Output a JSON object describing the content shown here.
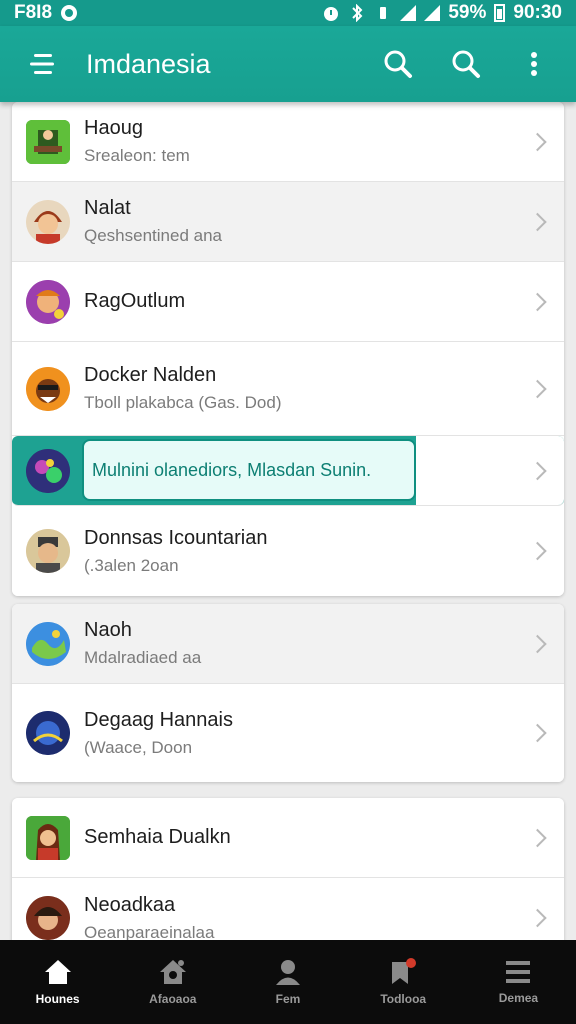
{
  "status_bar": {
    "time_left": "F8I8",
    "battery_pct": "59%",
    "clock": "90:30"
  },
  "app_bar": {
    "title": "Imdanesia",
    "icons": [
      "menu-icon",
      "search-icon",
      "search-icon",
      "more-vert-icon"
    ]
  },
  "colors": {
    "primary": "#17a090",
    "highlight_text": "#0d7f73",
    "nav_bg": "#0c0c0c"
  },
  "list": {
    "items": [
      {
        "name": "Haoug",
        "subtitle": "Srealeon: tem",
        "icon": "game-avatar-icon"
      },
      {
        "name": "Nalat",
        "subtitle": "Qeshsentined ana",
        "icon": "avatar-icon"
      },
      {
        "name": "RagOutlum",
        "subtitle": "",
        "icon": "avatar-icon"
      },
      {
        "name": "Docker Nalden",
        "subtitle": "Tboll plakabca (Gas. Dod)",
        "icon": "avatar-icon"
      },
      {
        "name": "Mulnini olanediors, Mlasdan Sunin.",
        "subtitle": "",
        "icon": "avatar-icon"
      },
      {
        "name": "Donnsas Icountarian",
        "subtitle": "(.3alen 2oan",
        "icon": "avatar-icon"
      },
      {
        "name": "Naoh",
        "subtitle": "Mdalradiaed aa",
        "icon": "globe-avatar-icon"
      },
      {
        "name": "Degaag Hannais",
        "subtitle": "(Waace, Doon",
        "icon": "avatar-icon"
      },
      {
        "name": "Semhaia Dualkn",
        "subtitle": "",
        "icon": "avatar-icon"
      },
      {
        "name": "Neoadkaa",
        "subtitle": "Oeanparaeinalaa",
        "icon": "avatar-icon"
      }
    ]
  },
  "bottom_nav": [
    {
      "label": "Hounes",
      "icon": "home-icon",
      "active": true
    },
    {
      "label": "Afaoaoa",
      "icon": "house-settings-icon",
      "active": false
    },
    {
      "label": "Fem",
      "icon": "person-icon",
      "active": false
    },
    {
      "label": "Todlooa",
      "icon": "notification-tag-icon",
      "active": false
    },
    {
      "label": "Demea",
      "icon": "menu-icon",
      "active": false
    }
  ]
}
